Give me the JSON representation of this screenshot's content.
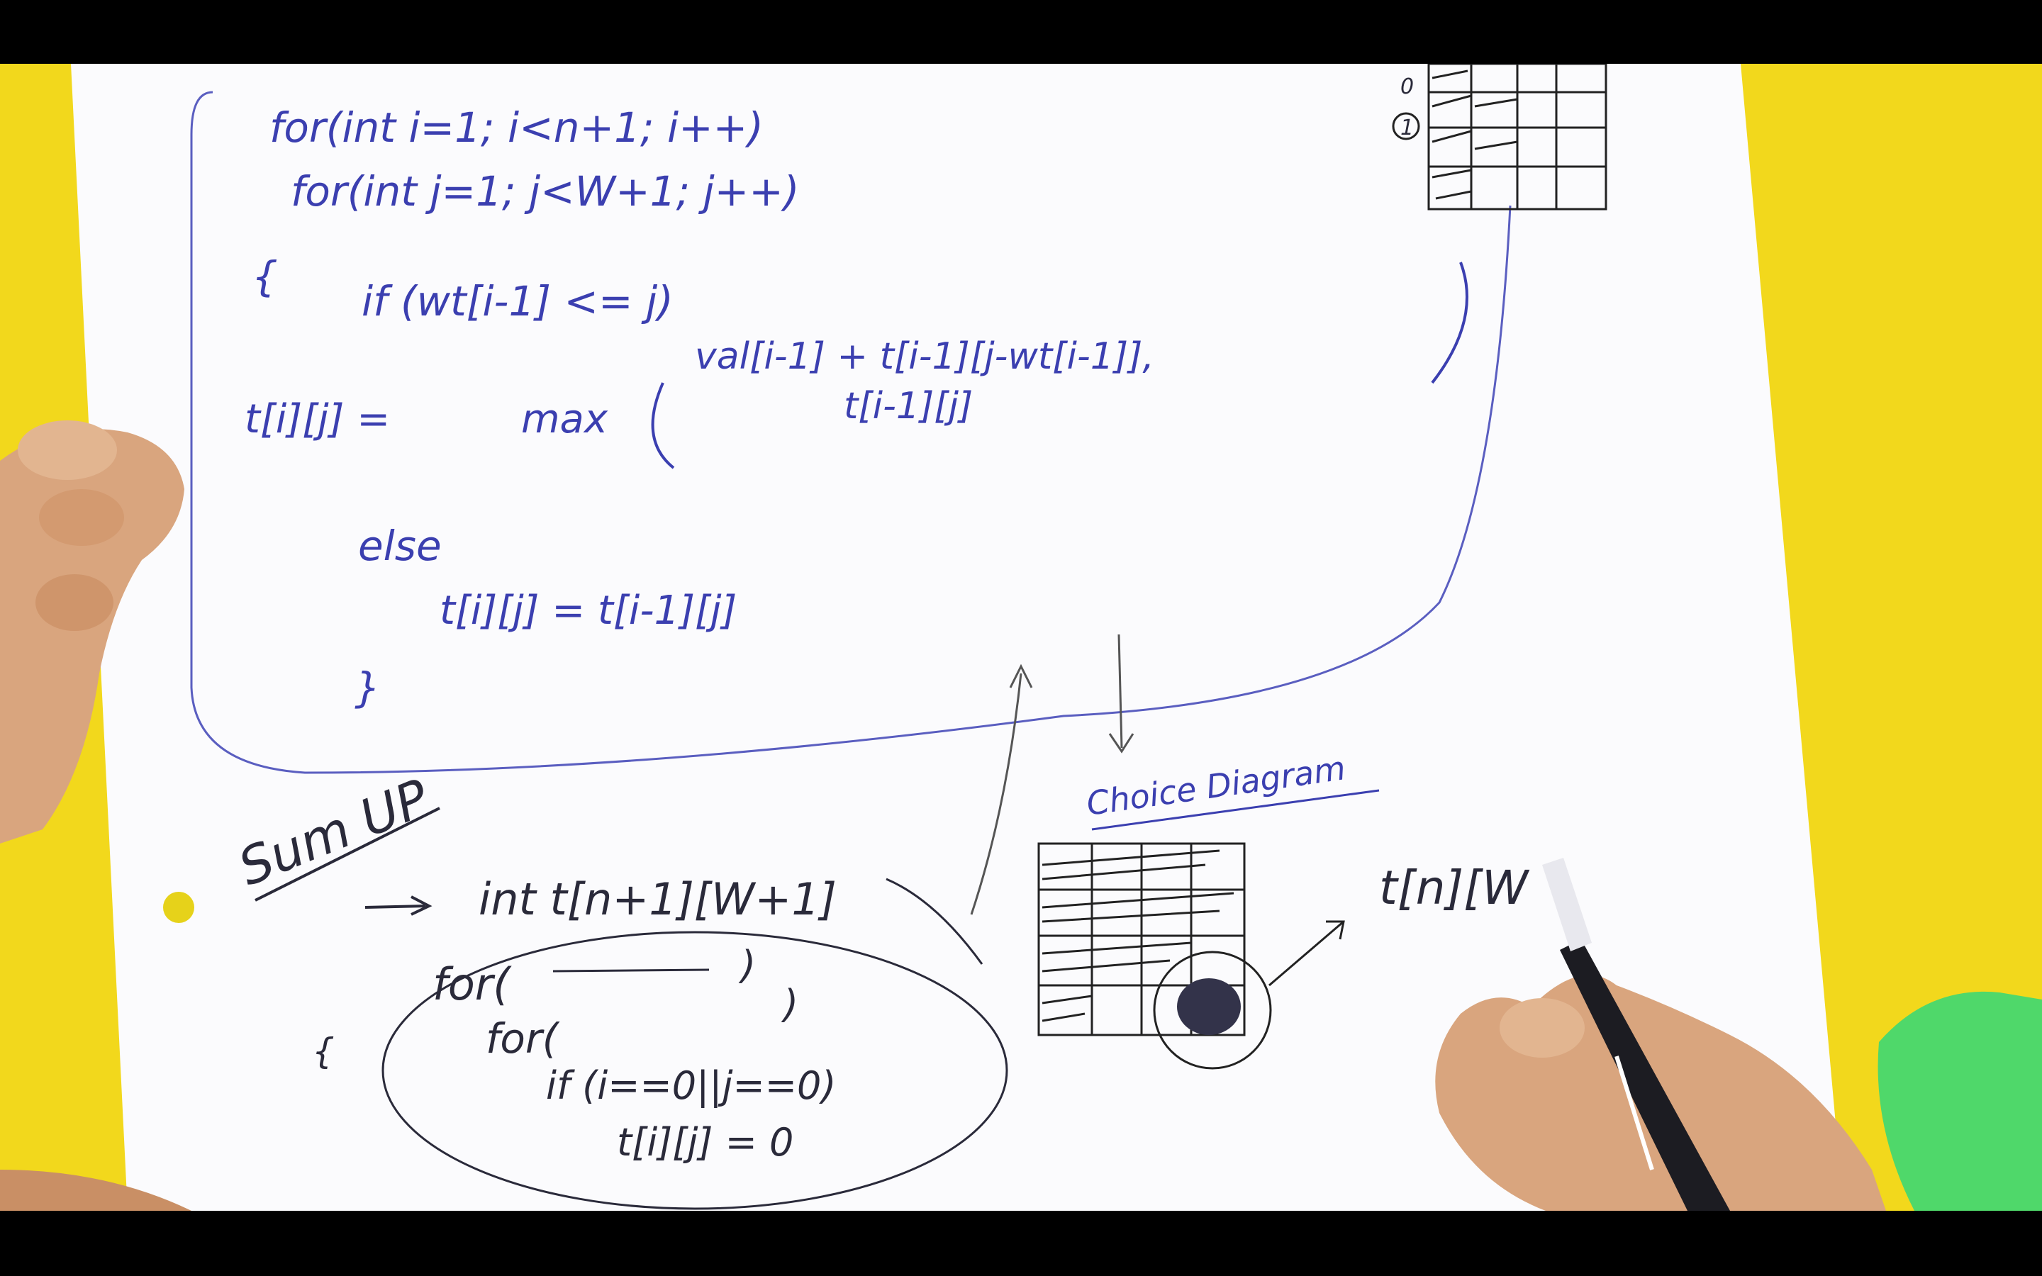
{
  "scene": {
    "description_kind": "video-frame",
    "colors": {
      "desk": "#f2d81c",
      "paper": "#fbfbfd",
      "ink_blue": "#3b3fb0",
      "ink_dark": "#2a2a3a",
      "skin": "#d9a57e",
      "pen": "#1c1c22",
      "sharpener": "#4fd86a"
    }
  },
  "code_block": {
    "line1": "for(int i=1; i<n+1; i++)",
    "line2": "for(int j=1; j<W+1; j++)",
    "open_brace": "{",
    "line3": "if (wt[i-1] <= j)",
    "line4_lhs": "t[i][j] =",
    "line4_fn": "max",
    "line4_arg1": "val[i-1] + t[i-1][j-wt[i-1]],",
    "line4_arg2": "t[i-1][j]",
    "line5": "else",
    "line6": "t[i][j] = t[i-1][j]",
    "close_brace": "}"
  },
  "grid_labels": {
    "row0": "0",
    "row1": "1"
  },
  "sum_up": {
    "title": "Sum UP",
    "decl": "int t[n+1][W+1]",
    "loop1": "for(",
    "loop1_end": ")",
    "loop2": "for(",
    "loop2_end": ")",
    "cond": "if (i==0||j==0)",
    "assign": "t[i][j] = 0",
    "brace": "{"
  },
  "choice_diagram": {
    "label": "Choice Diagram"
  },
  "answer": {
    "text": "t[n][W"
  }
}
